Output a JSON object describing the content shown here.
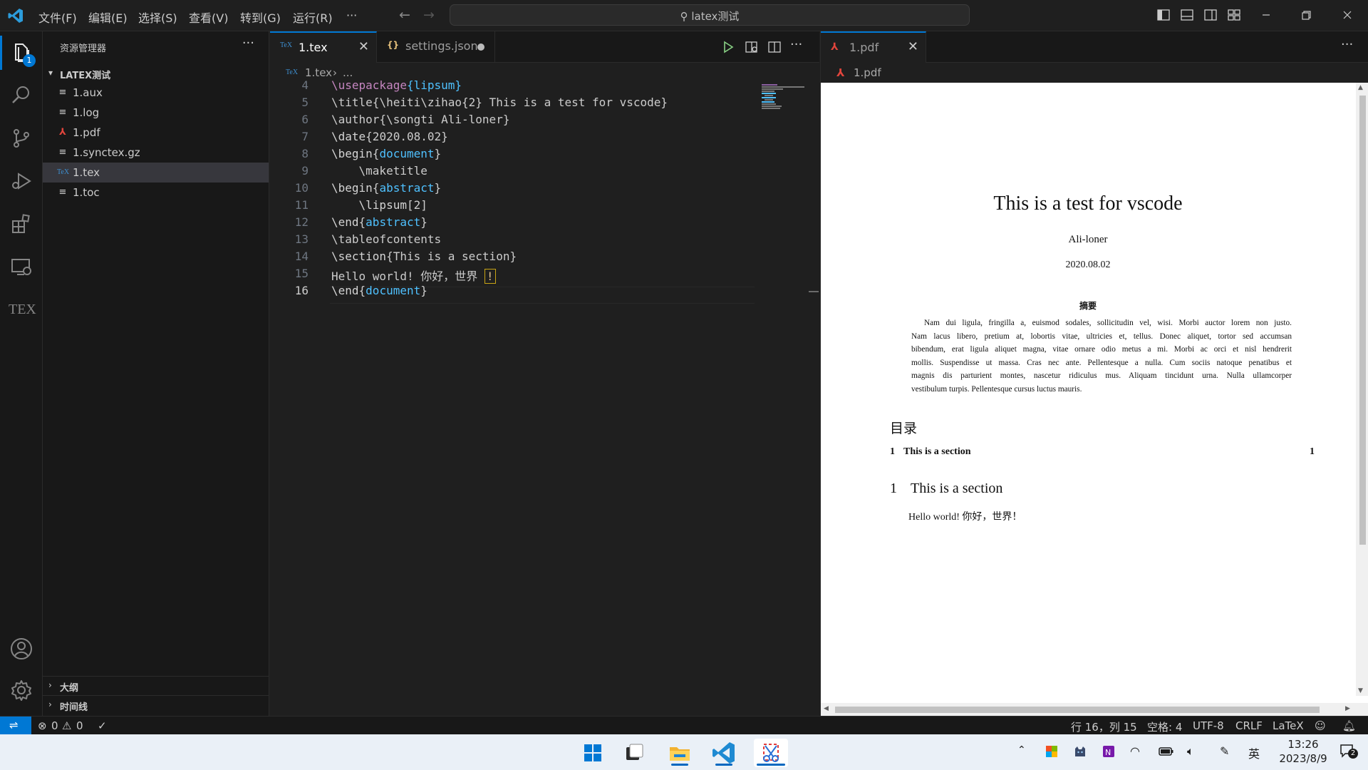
{
  "titlebar": {
    "menus": [
      "文件(F)",
      "编辑(E)",
      "选择(S)",
      "查看(V)",
      "转到(G)",
      "运行(R)",
      "···"
    ],
    "search_text": "latex测试"
  },
  "activitybar": {
    "explorer_badge": "1",
    "tex_label": "TEX"
  },
  "sidebar": {
    "title": "资源管理器",
    "more": "···",
    "folder": "LATEX测试",
    "files": [
      {
        "name": "1.aux",
        "icon": "file-lines-icon",
        "icon_text": "≡"
      },
      {
        "name": "1.log",
        "icon": "file-lines-icon",
        "icon_text": "≡"
      },
      {
        "name": "1.pdf",
        "icon": "pdf-icon",
        "icon_text": "⅄"
      },
      {
        "name": "1.synctex.gz",
        "icon": "file-lines-icon",
        "icon_text": "≡"
      },
      {
        "name": "1.tex",
        "icon": "tex-file-icon",
        "icon_text": "TeX",
        "selected": true
      },
      {
        "name": "1.toc",
        "icon": "file-lines-icon",
        "icon_text": "≡"
      }
    ],
    "outline": "大纲",
    "timeline": "时间线"
  },
  "editor1": {
    "tabs": [
      {
        "label": "1.tex",
        "icon_text": "TeX"
      },
      {
        "label": "settings.json",
        "icon_text": "{}"
      }
    ],
    "breadcrumb": {
      "file": "1.tex",
      "sep": "›",
      "rest": "..."
    },
    "gutter": [
      "4",
      "5",
      "6",
      "7",
      "8",
      "9",
      "10",
      "11",
      "12",
      "13",
      "14",
      "15",
      "16"
    ],
    "code": {
      "l4_cmd": "\\usepackage",
      "l4_arg": "{lipsum}",
      "l5": "\\title{\\heiti\\zihao{2} This is a test for vscode}",
      "l6": "\\author{\\songti Ali-loner}",
      "l7_cmd": "\\date",
      "l7_arg": "{2020.08.02}",
      "l8_cmd": "\\begin",
      "l8_b1": "{",
      "l8_arg": "document",
      "l8_b2": "}",
      "l9": "    \\maketitle",
      "l10_cmd": "\\begin",
      "l10_b1": "{",
      "l10_arg": "abstract",
      "l10_b2": "}",
      "l11_cmd": "    \\lipsum",
      "l11_arg": "[2]",
      "l12_cmd": "\\end",
      "l12_b1": "{",
      "l12_arg": "abstract",
      "l12_b2": "}",
      "l13": "\\tableofcontents",
      "l14_cmd": "\\section",
      "l14_arg": "{This is a section}",
      "l15": "Hello world! 你好，世界 ",
      "l15_hl": "!",
      "l16_cmd": "\\end",
      "l16_b1": "{",
      "l16_arg": "document",
      "l16_b2": "}"
    }
  },
  "editor2": {
    "tab": "1.pdf",
    "breadcrumb": "1.pdf",
    "more": "···",
    "pdf": {
      "title": "This is a test for vscode",
      "author": "Ali-loner",
      "date": "2020.08.02",
      "abstract_heading": "摘要",
      "abstract_lines": [
        "Nam dui ligula, fringilla a, euismod sodales, sollicitudin vel, wisi. Morbi auctor lorem non justo.",
        "Nam lacus libero, pretium at, lobortis vitae, ultricies et, tellus. Donec aliquet, tortor sed accumsan",
        "bibendum, erat ligula aliquet magna, vitae ornare odio metus a mi. Morbi ac orci et nisl hendrerit",
        "mollis. Suspendisse ut massa. Cras nec ante. Pellentesque a nulla. Cum sociis natoque penatibus et",
        "magnis dis parturient montes, nascetur ridiculus mus. Aliquam tincidunt urna. Nulla ullamcorper",
        "vestibulum turpis. Pellentesque cursus luctus mauris."
      ],
      "toc_heading": "目录",
      "toc_num": "1",
      "toc_title": "This is a section",
      "toc_page": "1",
      "section_num": "1",
      "section_title": "This is a section",
      "body": "Hello world! 你好，世界！"
    }
  },
  "statusbar": {
    "errors": "0",
    "warnings": "0",
    "cursor": "行 16，列 15",
    "indent": "空格: 4",
    "encoding": "UTF-8",
    "eol": "CRLF",
    "language": "LaTeX"
  },
  "taskbar": {
    "ime": "英",
    "time": "13:26",
    "date": "2023/8/9",
    "notification_count": "2"
  }
}
